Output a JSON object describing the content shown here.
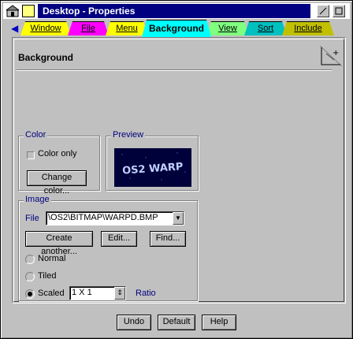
{
  "window": {
    "title": "Desktop - Properties",
    "titlebar_bg": "#000080",
    "min_icon": "minimize-icon",
    "max_icon": "maximize-icon"
  },
  "tabs": [
    {
      "label": "Window",
      "color": "#ffff00",
      "active": false
    },
    {
      "label": "File",
      "color": "#ff00ff",
      "active": false
    },
    {
      "label": "Menu",
      "color": "#ffff00",
      "active": false
    },
    {
      "label": "Background",
      "color": "#00ffff",
      "active": true
    },
    {
      "label": "View",
      "color": "#80ff80",
      "active": false
    },
    {
      "label": "Sort",
      "color": "#00c0c0",
      "active": false
    },
    {
      "label": "Include",
      "color": "#c0c000",
      "active": false
    }
  ],
  "page": {
    "title": "Background"
  },
  "color_group": {
    "label": "Color",
    "color_only_label": "Color only",
    "color_only_checked": false,
    "change_color_label": "Change color..."
  },
  "preview_group": {
    "label": "Preview",
    "image_text": "OS2 WARP"
  },
  "image_group": {
    "label": "Image",
    "file_label": "File",
    "file_value": "\\OS2\\BITMAP\\WARPD.BMP",
    "create_another_label": "Create another...",
    "edit_label": "Edit...",
    "find_label": "Find...",
    "options": [
      {
        "label": "Normal",
        "selected": false
      },
      {
        "label": "Tiled",
        "selected": false
      },
      {
        "label": "Scaled",
        "selected": true
      }
    ],
    "scale_value": "1 X 1",
    "ratio_label": "Ratio"
  },
  "buttons": {
    "undo": "Undo",
    "default": "Default",
    "help": "Help"
  }
}
